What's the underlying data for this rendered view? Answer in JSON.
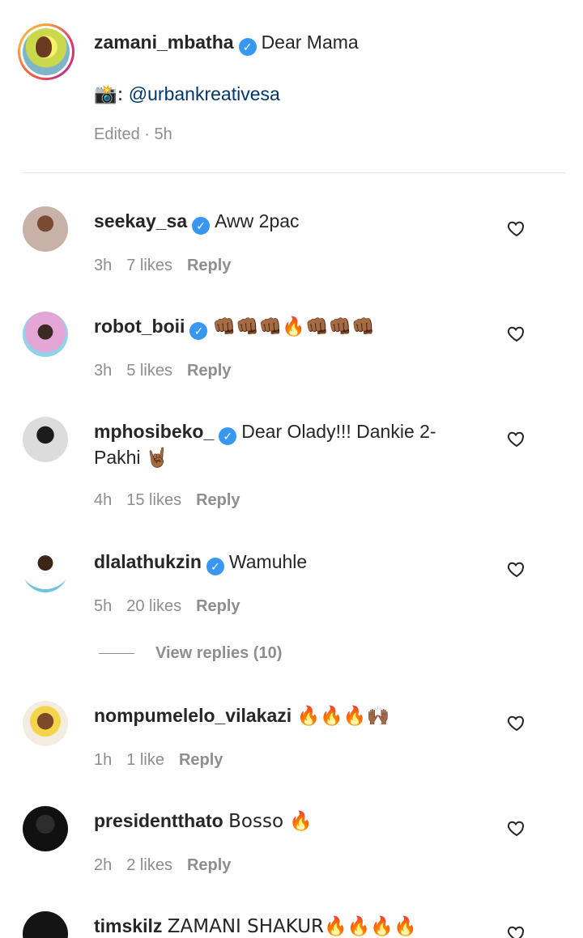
{
  "caption": {
    "username": "zamani_mbatha",
    "text": "Dear Mama",
    "credit_prefix": "📸:",
    "credit_mention": "@urbankreativesa",
    "meta": "Edited · 5h"
  },
  "comments": [
    {
      "username": "seekay_sa",
      "verified": true,
      "text": "Aww 2pac",
      "time": "3h",
      "likes": "7 likes",
      "reply": "Reply"
    },
    {
      "username": "robot_boii",
      "verified": true,
      "text": "👊🏾👊🏾👊🏾🔥👊🏾👊🏾👊🏾",
      "time": "3h",
      "likes": "5 likes",
      "reply": "Reply"
    },
    {
      "username": "mphosibeko_",
      "verified": true,
      "text": "Dear Olady!!! Dankie 2-Pakhi 🤘🏾",
      "time": "4h",
      "likes": "15 likes",
      "reply": "Reply"
    },
    {
      "username": "dlalathukzin",
      "verified": true,
      "text": "Wamuhle",
      "time": "5h",
      "likes": "20 likes",
      "reply": "Reply"
    },
    {
      "username": "nompumelelo_vilakazi",
      "verified": false,
      "text": "🔥🔥🔥🙌🏾",
      "time": "1h",
      "likes": "1 like",
      "reply": "Reply"
    },
    {
      "username": "presidentthato",
      "verified": false,
      "text": "Bosso 🔥",
      "time": "2h",
      "likes": "2 likes",
      "reply": "Reply"
    },
    {
      "username": "timskilz",
      "verified": false,
      "text": "ZAMANI SHAKUR🔥🔥🔥🔥",
      "time": "",
      "likes": "",
      "reply": ""
    }
  ],
  "view_replies": "View replies (10)",
  "colors": {
    "text": "#262626",
    "muted": "#8e8e8e",
    "mention": "#00376b",
    "verified": "#3897f0",
    "divider": "#e6e6e6"
  },
  "icons": {
    "verified": "verified-badge-icon",
    "like": "heart-outline-icon"
  }
}
